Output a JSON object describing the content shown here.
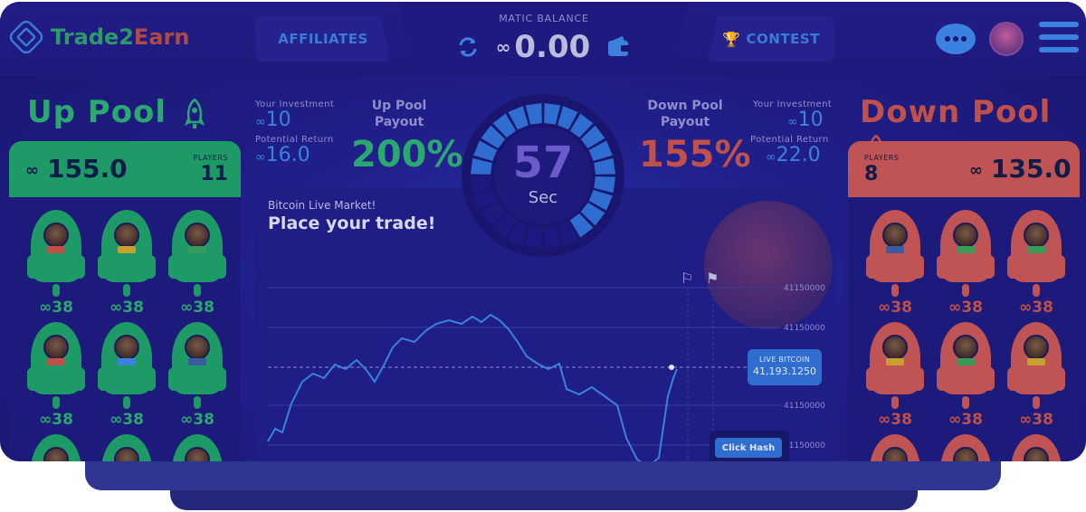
{
  "brand": {
    "name_part1": "Trade2",
    "name_part2": "Earn"
  },
  "nav": {
    "affiliates": "AFFILIATES",
    "contest": "CONTEST"
  },
  "balance": {
    "label": "MATIC BALANCE",
    "value": "0.00"
  },
  "up_pool": {
    "title": "Up Pool",
    "amount": "155.0",
    "players_label": "PLAYERS",
    "players": "11",
    "your_investment_label": "Your Investment",
    "your_investment": "10",
    "potential_return_label": "Potential Return",
    "potential_return": "16.0",
    "payout_label_1": "Up Pool",
    "payout_label_2": "Payout",
    "payout": "200%",
    "rockets": [
      {
        "value": "38",
        "flag": "#c0504a"
      },
      {
        "value": "38",
        "flag": "#c8a030"
      },
      {
        "value": "38",
        "flag": "#3a9a5a"
      },
      {
        "value": "38",
        "flag": "#c0504a"
      },
      {
        "value": "38",
        "flag": "#3b82e0"
      },
      {
        "value": "38",
        "flag": "#3b5aa0"
      }
    ]
  },
  "down_pool": {
    "title": "Down Pool",
    "amount": "135.0",
    "players_label": "PLAYERS",
    "players": "8",
    "your_investment_label": "Your Investment",
    "your_investment": "10",
    "potential_return_label": "Potential Return",
    "potential_return": "22.0",
    "payout_label_1": "Down Pool",
    "payout_label_2": "Payout",
    "payout": "155%",
    "rockets": [
      {
        "value": "38",
        "flag": "#3b5aa0"
      },
      {
        "value": "38",
        "flag": "#3a9a5a"
      },
      {
        "value": "38",
        "flag": "#3a9a5a"
      },
      {
        "value": "38",
        "flag": "#c8a030"
      },
      {
        "value": "38",
        "flag": "#3a9a5a"
      },
      {
        "value": "38",
        "flag": "#c8a030"
      }
    ]
  },
  "timer": {
    "seconds": "57",
    "unit": "Sec",
    "progress": 0.68
  },
  "market": {
    "subtitle": "Bitcoin Live Market!",
    "title": "Place your trade!",
    "live_label": "LIVE BITCOIN",
    "live_value": "41,193.1250",
    "click_hash": "Click Hash",
    "price_ticks": [
      "41150000",
      "41150000",
      "41150000",
      "41150000"
    ]
  },
  "colors": {
    "up": "#1e9a66",
    "down": "#c05454",
    "accent": "#3b82e0",
    "bg": "#1e1a7c"
  }
}
